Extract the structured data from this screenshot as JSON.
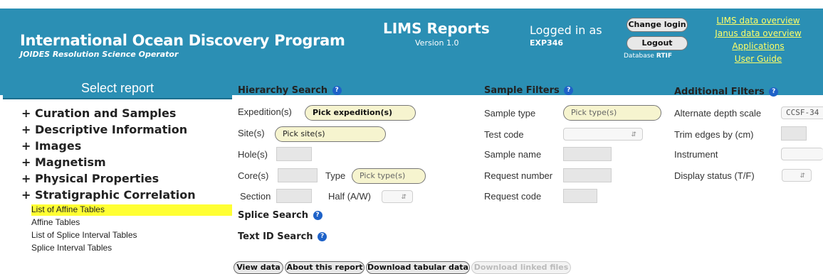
{
  "header": {
    "org_title": "International Ocean Discovery Program",
    "org_subtitle_italic": "JOIDES Resolution",
    "org_subtitle_rest": " Science Operator",
    "app_title": "LIMS Reports",
    "app_version": "Version 1.0",
    "logged_in_label": "Logged in as",
    "logged_in_user": "EXP346",
    "change_login": "Change login",
    "logout": "Logout",
    "database_label": "Database",
    "database_name": "RTIF",
    "links": [
      "LIMS data overview",
      "Janus data overview",
      "Applications",
      "User Guide"
    ],
    "color": "#2b8fb4",
    "link_color": "#ffff66"
  },
  "sidebar": {
    "title": "Select report",
    "categories": [
      "+ Curation and Samples",
      "+ Descriptive Information",
      "+ Images",
      "+ Magnetism",
      "+ Physical Properties",
      "+ Stratigraphic Correlation"
    ],
    "reports": [
      "List of Affine Tables",
      "Affine Tables",
      "List of Splice Interval Tables",
      "Splice Interval Tables"
    ],
    "selected_report": "List of Affine Tables",
    "highlight_color": "#ffff33"
  },
  "hierarchy": {
    "title": "Hierarchy Search",
    "expedition_label": "Expedition(s)",
    "expedition_btn": "Pick expedition(s)",
    "site_label": "Site(s)",
    "site_btn": "Pick site(s)",
    "hole_label": "Hole(s)",
    "core_label": "Core(s)",
    "type_label": "Type",
    "type_btn": "Pick type(s)",
    "section_label": "Section",
    "half_label": "Half (A/W)"
  },
  "splice_search": {
    "title": "Splice Search"
  },
  "text_id_search": {
    "title": "Text ID Search"
  },
  "sample_filters": {
    "title": "Sample Filters",
    "sample_type_label": "Sample type",
    "sample_type_btn": "Pick type(s)",
    "test_code_label": "Test code",
    "sample_name_label": "Sample name",
    "request_number_label": "Request number",
    "request_code_label": "Request code"
  },
  "additional_filters": {
    "title": "Additional Filters",
    "alt_depth_label": "Alternate depth scale",
    "alt_depth_value": "CCSF-34",
    "trim_label": "Trim edges by (cm)",
    "instrument_label": "Instrument",
    "display_status_label": "Display status (T/F)"
  },
  "icons": {
    "info": "info-icon",
    "select_arrows": "select-arrows-icon"
  },
  "actions": {
    "view_data": "View data",
    "about_report": "About this report",
    "download_tabular": "Download tabular data",
    "download_linked": "Download linked files"
  }
}
